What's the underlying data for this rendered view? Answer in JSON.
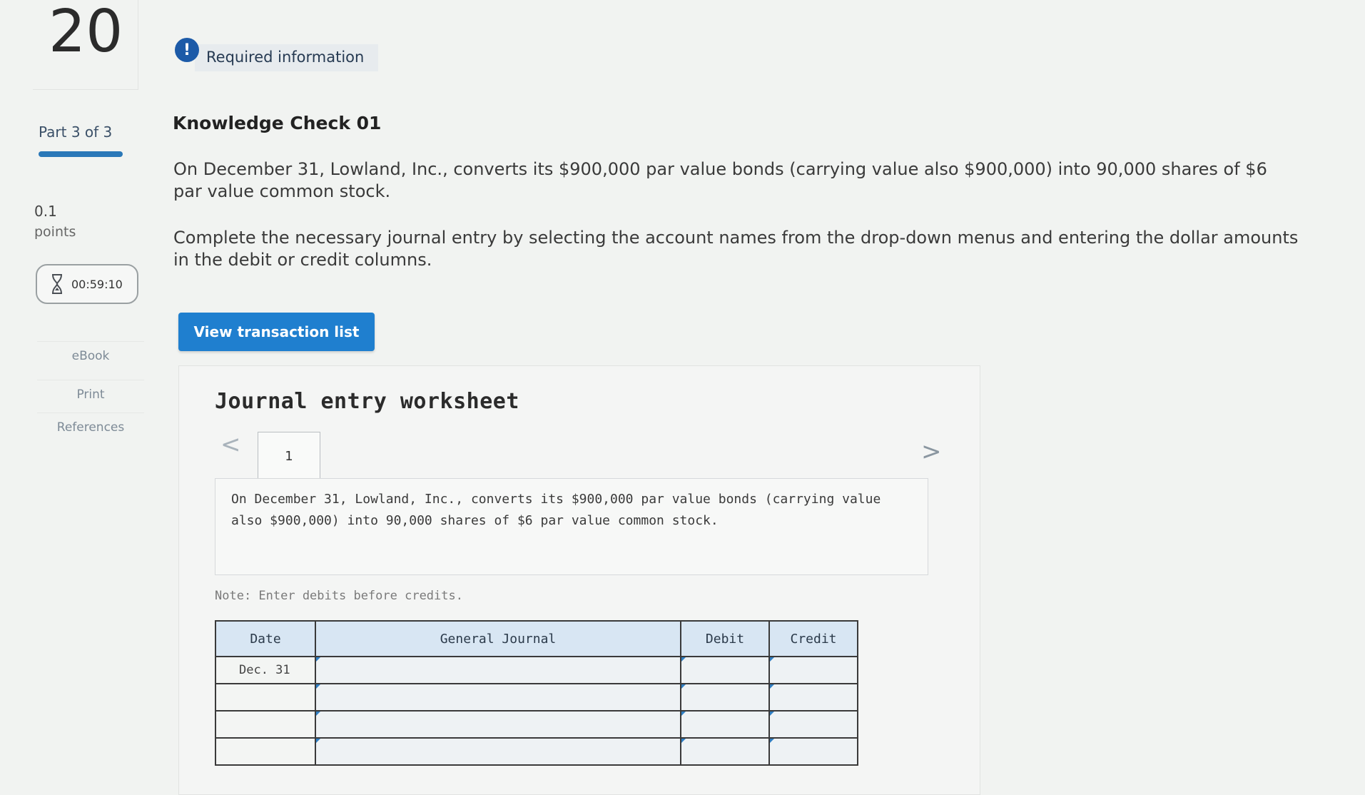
{
  "question": {
    "number": "20",
    "part": "Part 3 of 3",
    "points_value": "0.1",
    "points_label": "points",
    "timer": "00:59:10"
  },
  "rail": {
    "ebook": "eBook",
    "print": "Print",
    "references": "References"
  },
  "header": {
    "required_icon": "!",
    "required_text": "Required information"
  },
  "content": {
    "title": "Knowledge Check 01",
    "paragraph1": "On December 31, Lowland, Inc., converts its $900,000 par value bonds (carrying value also $900,000) into 90,000 shares of $6 par value common stock.",
    "paragraph2": "Complete the necessary journal entry by selecting the account names from the drop-down menus and entering the dollar amounts in the debit or credit columns.",
    "view_button": "View transaction list"
  },
  "worksheet": {
    "title": "Journal entry worksheet",
    "prev": "<",
    "next": ">",
    "tab": "1",
    "description": "On December 31, Lowland, Inc., converts its $900,000 par value bonds (carrying value also $900,000) into 90,000 shares of $6 par value common stock.",
    "note": "Note: Enter debits before credits.",
    "columns": {
      "date": "Date",
      "general_journal": "General Journal",
      "debit": "Debit",
      "credit": "Credit"
    },
    "rows": [
      {
        "date": "Dec. 31",
        "account": "",
        "debit": "",
        "credit": ""
      },
      {
        "date": "",
        "account": "",
        "debit": "",
        "credit": ""
      },
      {
        "date": "",
        "account": "",
        "debit": "",
        "credit": ""
      },
      {
        "date": "",
        "account": "",
        "debit": "",
        "credit": ""
      }
    ]
  },
  "colors": {
    "accent": "#1f7fcf",
    "badge": "#1c5aa8",
    "progress": "#2a78b8",
    "table_header": "#d8e6f3"
  },
  "icons": {
    "timer": "hourglass-icon",
    "required": "exclamation-icon",
    "prev": "chevron-left-icon",
    "next": "chevron-right-icon"
  }
}
